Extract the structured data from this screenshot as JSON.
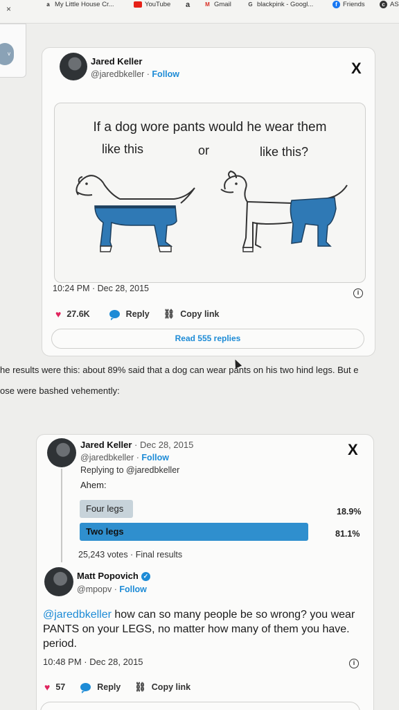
{
  "bookmarks": {
    "close": "×",
    "items": [
      {
        "icon": "a",
        "label": "My Little House Cr..."
      },
      {
        "icon": "yt",
        "label": "YouTube"
      },
      {
        "icon": "a",
        "label": "a"
      },
      {
        "icon": "M",
        "label": "Gmail"
      },
      {
        "icon": "G",
        "label": "blackpink - Googl..."
      },
      {
        "icon": "f",
        "label": "Friends"
      },
      {
        "icon": "c",
        "label": "AS"
      }
    ]
  },
  "side_panel": {
    "pill_glyph": "v"
  },
  "tweet1": {
    "name": "Jared Keller",
    "handle": "@jaredbkeller",
    "sep": " · ",
    "follow": "Follow",
    "x_logo": "X",
    "image": {
      "title": "If a dog wore pants would he wear them",
      "left_caption": "like this",
      "or_text": "or",
      "right_caption": "like this?"
    },
    "timestamp": "10:24 PM · Dec 28, 2015",
    "info": "i",
    "likes": "27.6K",
    "reply": "Reply",
    "copy_link": "Copy link",
    "read_replies": "Read 555 replies"
  },
  "article": {
    "line1": "he results were this: about 89% said that a dog can wear pants on his two hind legs. But e",
    "line2": "ose were bashed vehemently:"
  },
  "tweet2": {
    "name": "Jared Keller",
    "date": " · Dec 28, 2015",
    "handle": "@jaredbkeller",
    "sep": " · ",
    "follow": "Follow",
    "x_logo": "X",
    "replying_to": "Replying to @jaredbkeller",
    "text": "Ahem:",
    "poll": [
      {
        "label": "Four legs",
        "percent": "18.9%",
        "value": 18.9
      },
      {
        "label": "Two legs",
        "percent": "81.1%",
        "value": 81.1
      }
    ],
    "votes": "25,243 votes · Final results"
  },
  "reply": {
    "name": "Matt Popovich",
    "verified": "✓",
    "handle": "@mpopv",
    "sep": " · ",
    "follow": "Follow",
    "mention": "@jaredbkeller",
    "text": " how can so many people be so wrong? you wear PANTS on your LEGS, no matter how many of them you have. period.",
    "timestamp": "10:48 PM · Dec 28, 2015",
    "info": "i",
    "likes": "57",
    "reply": "Reply",
    "copy_link": "Copy link"
  },
  "colors": {
    "accent": "#1d8bd6",
    "heart": "#e0245e",
    "poll_winner": "#2f8fce",
    "poll_loser": "#c7d3da"
  }
}
